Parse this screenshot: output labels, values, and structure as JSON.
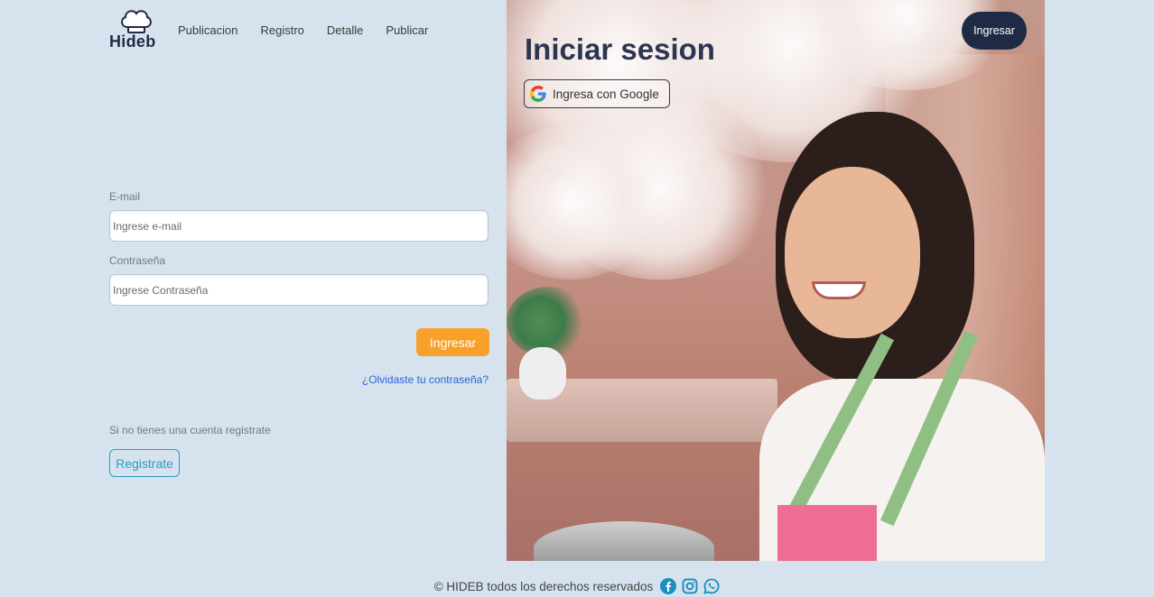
{
  "brand": {
    "name": "Hideb"
  },
  "nav": {
    "items": [
      {
        "label": "Publicacion"
      },
      {
        "label": "Registro"
      },
      {
        "label": "Detalle"
      },
      {
        "label": "Publicar"
      }
    ]
  },
  "header": {
    "login_button": "Ingresar"
  },
  "hero": {
    "title": "Iniciar sesion",
    "google_button": "Ingresa con Google"
  },
  "form": {
    "email_label": "E-mail",
    "email_placeholder": "Ingrese e-mail",
    "password_label": "Contraseña",
    "password_placeholder": "Ingrese Contraseña",
    "submit_label": "Ingresar",
    "forgot_link": "¿Olvidaste tu contraseña?",
    "no_account_text": "Si no tienes una cuenta registrate",
    "register_button": "Registrate"
  },
  "footer": {
    "copyright": "© HIDEB todos los derechos reservados",
    "social_icons": [
      "facebook-icon",
      "instagram-icon",
      "whatsapp-icon"
    ]
  },
  "colors": {
    "background": "#d6e3ee",
    "primary_dark": "#1f2a44",
    "accent_orange": "#f8a12a",
    "link_blue": "#2b63d9",
    "outline_teal": "#2a9dc1",
    "social_blue": "#1a8fc1"
  }
}
